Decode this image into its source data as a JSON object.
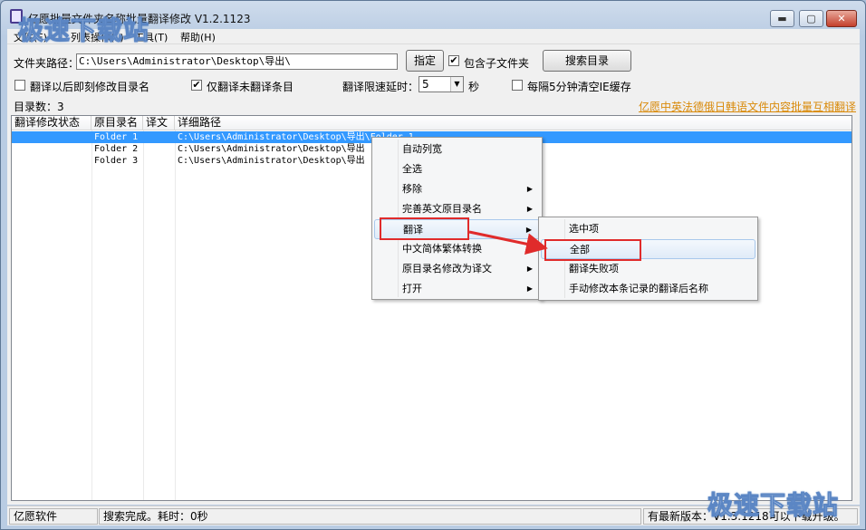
{
  "window": {
    "title": "亿愿批量文件夹名称批量翻译修改 V1.2.1123",
    "controls": {
      "minimize": "▬",
      "maximize": "▢",
      "close": "✕"
    }
  },
  "menu": [
    "文件(F)",
    "列表操作(L)",
    "工具(T)",
    "帮助(H)"
  ],
  "toolbar": {
    "folder_path_label": "文件夹路径：",
    "folder_path_value": "C:\\Users\\Administrator\\Desktop\\导出\\",
    "specify_button": "指定",
    "include_subfolders_label": "包含子文件夹",
    "include_subfolders_checked": true,
    "search_button": "搜索目录",
    "rename_after_translate_label": "翻译以后即刻修改目录名",
    "rename_after_translate_checked": false,
    "only_untranslated_label": "仅翻译未翻译条目",
    "only_untranslated_checked": true,
    "delay_label": "翻译限速延时：",
    "delay_value": "5",
    "delay_unit": "秒",
    "clear_ie_cache_label": "每隔5分钟清空IE缓存",
    "clear_ie_cache_checked": false
  },
  "dir_count_label": "目录数：3",
  "promo_link": "亿愿中英法德俄日韩语文件内容批量互相翻译",
  "list": {
    "columns": [
      "翻译修改状态",
      "原目录名",
      "译文",
      "详细路径"
    ],
    "rows": [
      {
        "status": "",
        "name": "Folder 1",
        "translation": "",
        "path": "C:\\Users\\Administrator\\Desktop\\导出\\Folder 1"
      },
      {
        "status": "",
        "name": "Folder 2",
        "translation": "",
        "path": "C:\\Users\\Administrator\\Desktop\\导出"
      },
      {
        "status": "",
        "name": "Folder 3",
        "translation": "",
        "path": "C:\\Users\\Administrator\\Desktop\\导出"
      }
    ],
    "selected_row": 0
  },
  "context_menu": {
    "items": [
      {
        "label": "自动列宽",
        "submenu": false
      },
      {
        "label": "全选",
        "submenu": false
      },
      {
        "label": "移除",
        "submenu": true
      },
      {
        "label": "完善英文原目录名",
        "submenu": true
      },
      {
        "label": "翻译",
        "submenu": true
      },
      {
        "label": "中文简体繁体转换",
        "submenu": true
      },
      {
        "label": "原目录名修改为译文",
        "submenu": true
      },
      {
        "label": "打开",
        "submenu": true
      }
    ],
    "highlighted": "翻译"
  },
  "submenu": {
    "items": [
      "选中项",
      "全部",
      "翻译失败项",
      "手动修改本条记录的翻译后名称"
    ],
    "highlighted": "全部"
  },
  "annotation_color": "#e02b2b",
  "statusbar": {
    "company": "亿愿软件",
    "status": "搜索完成。耗时：0秒",
    "update": "有最新版本：V1.3.1218可以下载升级。"
  },
  "watermark": "极速下载站"
}
